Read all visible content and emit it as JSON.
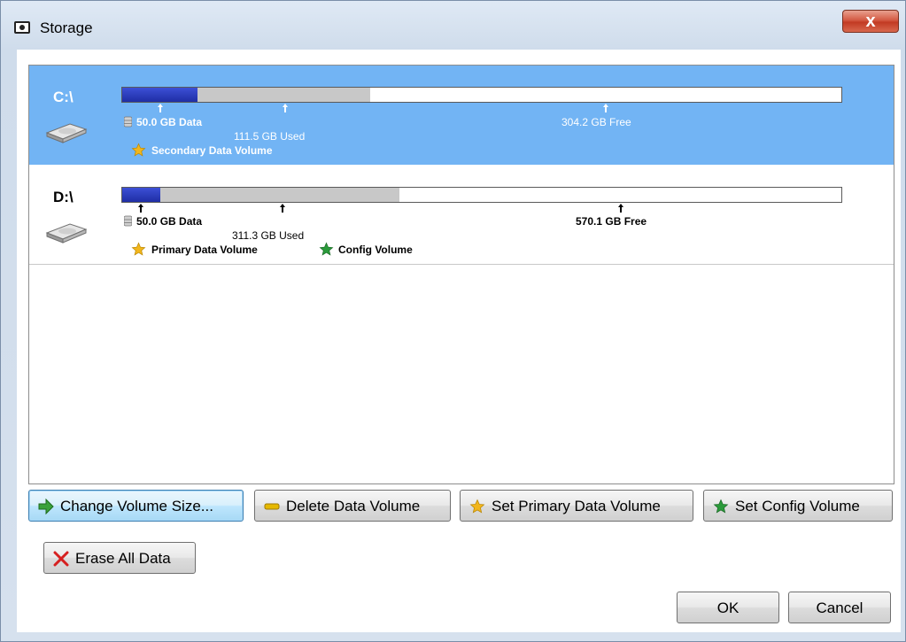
{
  "window": {
    "title": "Storage",
    "close_glyph": "x"
  },
  "volumes": [
    {
      "drive": "C:\\",
      "selected": true,
      "data_label": "50.0 GB Data",
      "used_label": "111.5 GB Used",
      "free_label": "304.2 GB Free",
      "data_fraction": 0.105,
      "used_fraction": 0.345,
      "roles": [
        "Secondary Data Volume"
      ],
      "role_icons": [
        "gold-star-icon"
      ]
    },
    {
      "drive": "D:\\",
      "selected": false,
      "data_label": "50.0 GB Data",
      "used_label": "311.3 GB Used",
      "free_label": "570.1 GB Free",
      "data_fraction": 0.053,
      "used_fraction": 0.386,
      "roles": [
        "Primary Data Volume",
        "Config Volume"
      ],
      "role_icons": [
        "gold-star-icon",
        "green-star-icon"
      ]
    }
  ],
  "buttons": {
    "change_size": "Change Volume Size...",
    "delete_volume": "Delete Data Volume",
    "set_primary": "Set Primary Data Volume",
    "set_config": "Set Config Volume",
    "erase_all": "Erase All Data",
    "ok": "OK",
    "cancel": "Cancel"
  },
  "colors": {
    "selection": "#72b4f4",
    "data_bar": "#2a3bc0",
    "used_bar": "#c8c8c8",
    "gold_star": "#f2b61c",
    "green_star": "#2a9a3a",
    "delete_icon": "#e6b800",
    "erase_icon": "#d62020",
    "change_icon": "#3aa13a"
  }
}
